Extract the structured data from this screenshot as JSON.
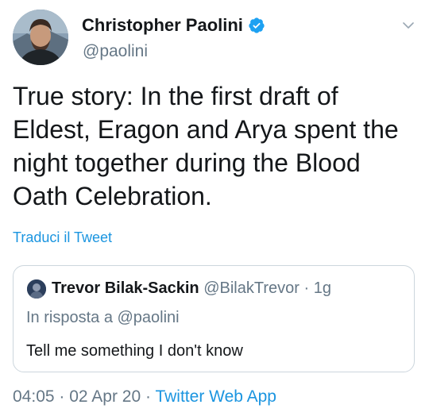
{
  "author": {
    "display_name": "Christopher Paolini",
    "handle": "@paolini",
    "verified": true,
    "avatar_icon": "profile-photo"
  },
  "tweet": {
    "text": "True story: In the first draft of Eldest, Eragon and Arya spent the night together during the Blood Oath Celebration.",
    "translate_label": "Traduci il Tweet"
  },
  "quoted": {
    "display_name": "Trevor Bilak-Sackin",
    "handle": "@BilakTrevor",
    "separator": "·",
    "time": "1g",
    "reply_to": "In risposta a @paolini",
    "text": "Tell me something I don't know"
  },
  "footer": {
    "time": "04:05",
    "sep1": "·",
    "date": "02 Apr 20",
    "sep2": "·",
    "app": "Twitter Web App"
  },
  "colors": {
    "text": "#14171a",
    "secondary": "#657786",
    "accent": "#1b95e0",
    "verified": "#1da1f2",
    "border": "#ccd6dd"
  }
}
